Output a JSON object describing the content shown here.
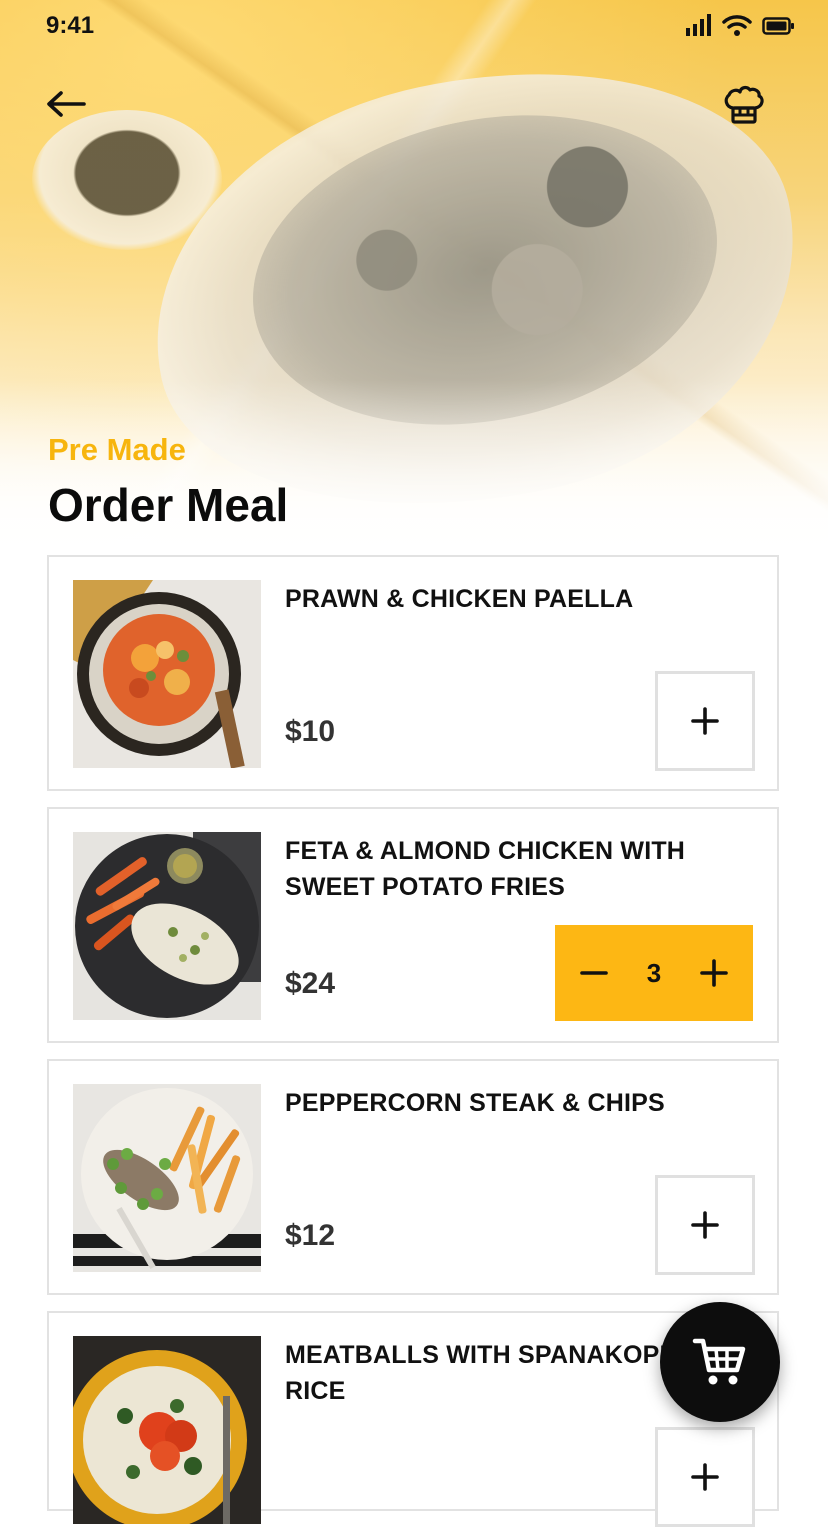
{
  "status_bar": {
    "time": "9:41"
  },
  "header": {
    "back_icon": "arrow-left-icon",
    "chef_icon": "chef-hat-icon",
    "subtitle": "Pre Made",
    "title": "Order Meal",
    "accent_color": "#FDB714"
  },
  "meals": [
    {
      "name": "PRAWN & CHICKEN PAELLA",
      "price": "$10",
      "quantity": 0
    },
    {
      "name_line1": "FETA & ALMOND CHICKEN WITH",
      "name_line2": "SWEET POTATO FRIES",
      "price": "$24",
      "quantity": "3"
    },
    {
      "name": "PEPPERCORN STEAK & CHIPS",
      "price": "$12",
      "quantity": 0
    },
    {
      "name_line1": "MEATBALLS WITH SPANAKOPITA",
      "name_line2": "RICE",
      "price": "",
      "quantity": 0
    }
  ],
  "cart": {
    "icon": "shopping-cart-icon"
  }
}
